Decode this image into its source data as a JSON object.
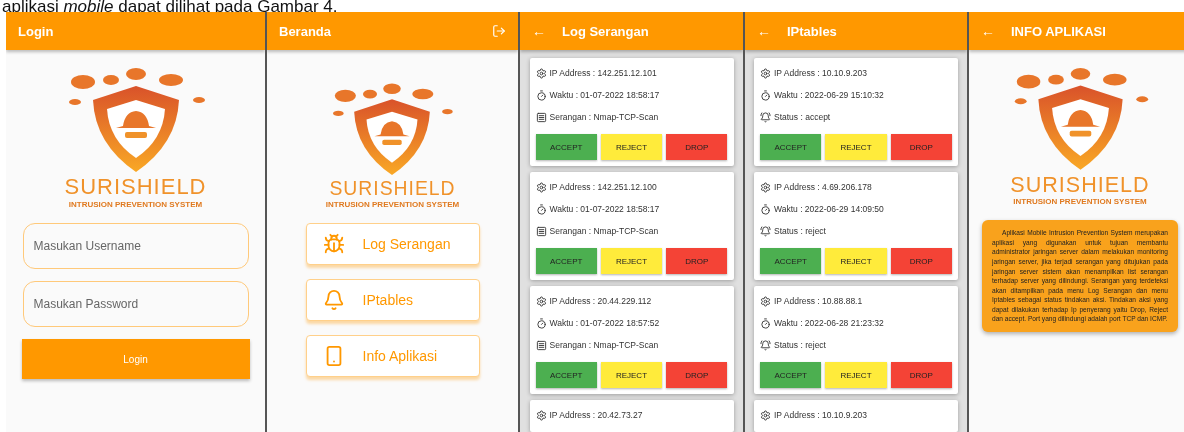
{
  "caption": "aplikasi *mobile* dapat dilihat pada Gambar 4.",
  "screens": [
    {
      "kind": "login",
      "title": "Login",
      "logo": {
        "name": "SURISHIELD",
        "tagline": "INTRUSION PREVENTION SYSTEM"
      },
      "fields": [
        {
          "placeholder": "Masukan Username"
        },
        {
          "placeholder": "Masukan Password"
        }
      ],
      "button": "Login"
    },
    {
      "kind": "home",
      "title": "Beranda",
      "logo": {
        "name": "SURISHIELD",
        "tagline": "INTRUSION PREVENTION SYSTEM"
      },
      "menu": [
        {
          "label": "Log Serangan"
        },
        {
          "label": "IPtables"
        },
        {
          "label": "Info Aplikasi"
        }
      ]
    },
    {
      "kind": "list",
      "title": "Log Serangan",
      "back": "←",
      "cards": [
        {
          "rows": [
            {
              "kind": "ip",
              "text": "IP Address :  142.251.12.101"
            },
            {
              "kind": "time",
              "text": "Waktu : 01-07-2022 18:58:17"
            },
            {
              "kind": "attack",
              "text": "Serangan : Nmap-TCP-Scan"
            }
          ],
          "actions": [
            {
              "kind": "accept",
              "label": "ACCEPT"
            },
            {
              "kind": "reject",
              "label": "REJECT"
            },
            {
              "kind": "drop",
              "label": "DROP"
            }
          ]
        },
        {
          "rows": [
            {
              "kind": "ip",
              "text": "IP Address :  142.251.12.100"
            },
            {
              "kind": "time",
              "text": "Waktu : 01-07-2022 18:58:17"
            },
            {
              "kind": "attack",
              "text": "Serangan : Nmap-TCP-Scan"
            }
          ],
          "actions": [
            {
              "kind": "accept",
              "label": "ACCEPT"
            },
            {
              "kind": "reject",
              "label": "REJECT"
            },
            {
              "kind": "drop",
              "label": "DROP"
            }
          ]
        },
        {
          "rows": [
            {
              "kind": "ip",
              "text": "IP Address :  20.44.229.112"
            },
            {
              "kind": "time",
              "text": "Waktu : 01-07-2022 18:57:52"
            },
            {
              "kind": "attack",
              "text": "Serangan : Nmap-TCP-Scan"
            }
          ],
          "actions": [
            {
              "kind": "accept",
              "label": "ACCEPT"
            },
            {
              "kind": "reject",
              "label": "REJECT"
            },
            {
              "kind": "drop",
              "label": "DROP"
            }
          ]
        },
        {
          "rows": [
            {
              "kind": "ip",
              "text": "IP Address :  20.42.73.27"
            }
          ]
        }
      ]
    },
    {
      "kind": "list",
      "title": "IPtables",
      "back": "←",
      "cards": [
        {
          "rows": [
            {
              "kind": "ip",
              "text": "IP Address : 10.10.9.203"
            },
            {
              "kind": "time",
              "text": "Waktu : 2022-06-29 15:10:32"
            },
            {
              "kind": "status",
              "text": "Status : accept"
            }
          ],
          "actions": [
            {
              "kind": "accept",
              "label": "ACCEPT"
            },
            {
              "kind": "reject",
              "label": "REJECT"
            },
            {
              "kind": "drop",
              "label": "DROP"
            }
          ]
        },
        {
          "rows": [
            {
              "kind": "ip",
              "text": "IP Address : 4.69.206.178"
            },
            {
              "kind": "time",
              "text": "Waktu : 2022-06-29 14:09:50"
            },
            {
              "kind": "status",
              "text": "Status : reject"
            }
          ],
          "actions": [
            {
              "kind": "accept",
              "label": "ACCEPT"
            },
            {
              "kind": "reject",
              "label": "REJECT"
            },
            {
              "kind": "drop",
              "label": "DROP"
            }
          ]
        },
        {
          "rows": [
            {
              "kind": "ip",
              "text": "IP Address : 10.88.88.1"
            },
            {
              "kind": "time",
              "text": "Waktu : 2022-06-28 21:23:32"
            },
            {
              "kind": "status",
              "text": "Status : reject"
            }
          ],
          "actions": [
            {
              "kind": "accept",
              "label": "ACCEPT"
            },
            {
              "kind": "reject",
              "label": "REJECT"
            },
            {
              "kind": "drop",
              "label": "DROP"
            }
          ]
        },
        {
          "rows": [
            {
              "kind": "ip",
              "text": "IP Address : 10.10.9.203"
            }
          ]
        }
      ]
    },
    {
      "kind": "info",
      "title": "INFO APLIKASI",
      "back": "←",
      "logo": {
        "name": "SURISHIELD",
        "tagline": "INTRUSION PREVENTION SYSTEM"
      },
      "text": "Aplikasi Mobile Intrusion Prevention System merupakan aplikasi yang digunakan untuk tujuan membantu administrator jaringan server dalam melakukan monitoring jaringan server, jika terjadi serangan yang ditujukan pada jaringan server sistem akan menampilkan list serangan terhadap server yang dilindungi. Serangan yang terdeteksi akan ditampilkan pada menu Log Serangan dan menu Iptables sebagai status tindakan aksi. Tindakan aksi yang dapat dilakukan terhadap Ip penyerang yaitu Drop, Reject dan accept. Port yang dilindungi adalah port TCP dan ICMP."
    }
  ]
}
